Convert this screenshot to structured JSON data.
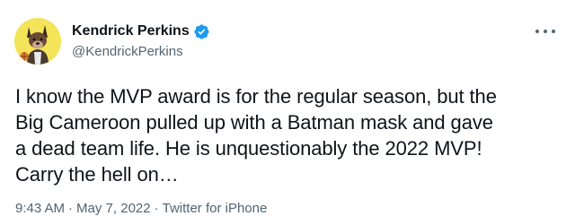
{
  "author": {
    "display_name": "Kendrick Perkins",
    "handle": "@KendrickPerkins",
    "verified": true,
    "verified_color": "#1d9bf0"
  },
  "tweet": {
    "text_lines": [
      "I know the MVP award is for the regular season, but the",
      "Big Cameroon pulled up with a Batman mask and gave",
      "a dead team life. He is unquestionably the 2022 MVP!",
      "Carry the hell on…"
    ]
  },
  "meta": {
    "time": "9:43 AM",
    "separator": "·",
    "date": "May 7, 2022",
    "source": "Twitter for iPhone"
  },
  "icons": {
    "avatar": "avatar-cartoon-dog",
    "verified": "verified-badge-icon",
    "more": "more-options-icon"
  },
  "colors": {
    "text_primary": "#0f1419",
    "text_secondary": "#536471",
    "avatar_bg": "#f4e45a"
  }
}
